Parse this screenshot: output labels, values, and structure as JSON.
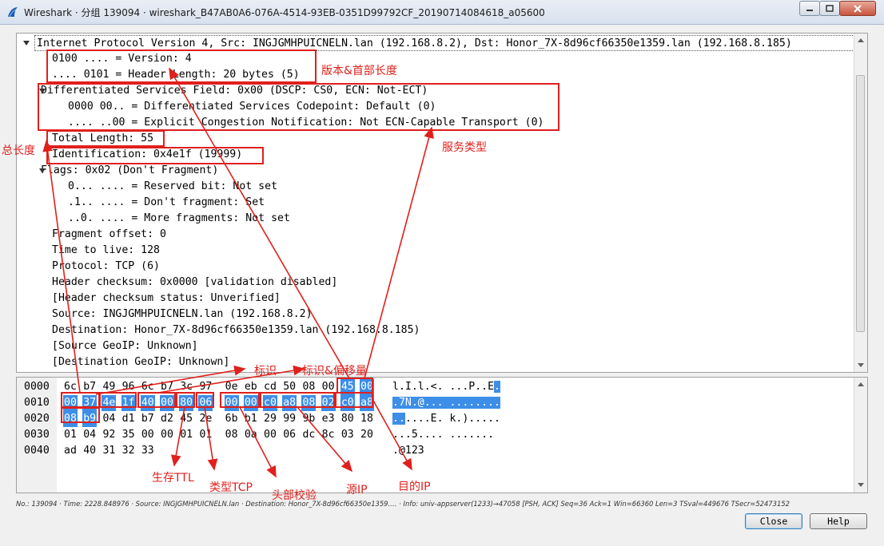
{
  "window": {
    "title": "Wireshark · 分组 139094 · wireshark_B47AB0A6-076A-4514-93EB-0351D99792CF_20190714084618_a05600"
  },
  "tree": [
    {
      "text": "Internet Protocol Version 4, Src: INGJGMHPUICNELN.lan (192.168.8.2), Dst: Honor_7X-8d96cf66350e1359.lan (192.168.8.185)",
      "expanded": true
    },
    {
      "text": "0100 .... = Version: 4"
    },
    {
      "text": ".... 0101 = Header Length: 20 bytes (5)"
    },
    {
      "text": "Differentiated Services Field: 0x00 (DSCP: CS0, ECN: Not-ECT)",
      "expanded": true
    },
    {
      "text": "0000 00.. = Differentiated Services Codepoint: Default (0)"
    },
    {
      "text": ".... ..00 = Explicit Congestion Notification: Not ECN-Capable Transport (0)"
    },
    {
      "text": "Total Length: 55"
    },
    {
      "text": "Identification: 0x4e1f (19999)"
    },
    {
      "text": "Flags: 0x02 (Don't Fragment)",
      "expanded": true
    },
    {
      "text": "0... .... = Reserved bit: Not set"
    },
    {
      "text": ".1.. .... = Don't fragment: Set"
    },
    {
      "text": "..0. .... = More fragments: Not set"
    },
    {
      "text": "Fragment offset: 0"
    },
    {
      "text": "Time to live: 128"
    },
    {
      "text": "Protocol: TCP (6)"
    },
    {
      "text": "Header checksum: 0x0000 [validation disabled]"
    },
    {
      "text": "[Header checksum status: Unverified]"
    },
    {
      "text": "Source: INGJGMHPUICNELN.lan (192.168.8.2)"
    },
    {
      "text": "Destination: Honor_7X-8d96cf66350e1359.lan (192.168.8.185)"
    },
    {
      "text": "[Source GeoIP: Unknown]"
    },
    {
      "text": "[Destination GeoIP: Unknown]"
    }
  ],
  "hex": [
    {
      "offset": "0000",
      "bytes": [
        "6c",
        "b7",
        "49",
        "96",
        "6c",
        "b7",
        "3c",
        "97",
        "0e",
        "eb",
        "cd",
        "50",
        "08",
        "00",
        "45",
        "00"
      ],
      "ascii": "l.I.l.<. ...P..E."
    },
    {
      "offset": "0010",
      "bytes": [
        "00",
        "37",
        "4e",
        "1f",
        "40",
        "00",
        "80",
        "06",
        "00",
        "00",
        "c0",
        "a8",
        "08",
        "02",
        "c0",
        "a8"
      ],
      "ascii": ".7N.@... ........"
    },
    {
      "offset": "0020",
      "bytes": [
        "08",
        "b9",
        "04",
        "d1",
        "b7",
        "d2",
        "45",
        "2e",
        "6b",
        "b1",
        "29",
        "99",
        "9b",
        "e3",
        "80",
        "18"
      ],
      "ascii": "......E. k.)....."
    },
    {
      "offset": "0030",
      "bytes": [
        "01",
        "04",
        "92",
        "35",
        "00",
        "00",
        "01",
        "01",
        "08",
        "0a",
        "00",
        "06",
        "dc",
        "8c",
        "03",
        "20"
      ],
      "ascii": "...5.... ....... "
    },
    {
      "offset": "0040",
      "bytes": [
        "ad",
        "40",
        "31",
        "32",
        "33"
      ],
      "ascii": ".@123"
    }
  ],
  "status_bar": "No.: 139094 · Time: 2228.848976 · Source: INGJGMHPUICNELN.lan · Destination: Honor_7X-8d96cf66350e1359.… · Info: univ-appserver(1233)→47058 [PSH, ACK] Seq=36 Ack=1 Win=66360 Len=3 TSval=449676 TSecr=52473152",
  "buttons": {
    "close": "Close",
    "help": "Help"
  },
  "annotations": {
    "version": "版本&首部长度",
    "service": "服务类型",
    "total_len": "总长度",
    "ident": "标识",
    "ident_offset": "标识&偏移量",
    "ttl": "生存TTL",
    "proto": "类型TCP",
    "checksum": "头部校验",
    "src": "源IP",
    "dst": "目的IP"
  },
  "colors": {
    "highlight": "#3d8ee8",
    "annotation": "#e0201c"
  }
}
